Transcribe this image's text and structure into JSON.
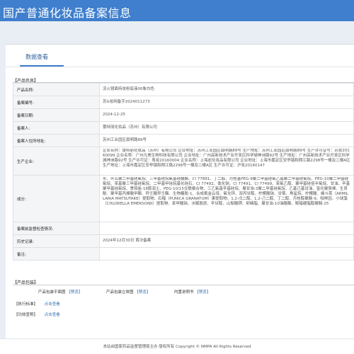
{
  "header": {
    "site_title": "国产普通化妆品备案信息"
  },
  "tabs": {
    "active": "数据查看"
  },
  "product_info": {
    "section_title": "【产品信息】",
    "rows": [
      {
        "label": "产品名称:",
        "value": "凉火镜面持妆粉底液00象白色"
      },
      {
        "label": "备案编号:",
        "value": "苏G妆网备字2024011273"
      },
      {
        "label": "备案日期:",
        "value": "2024-12-25"
      },
      {
        "label": "备案人:",
        "value": "蕾特丽化妆品（苏州）有限公司"
      },
      {
        "label": "备案人住所地址:",
        "value": "苏州工业园区扇明路89号"
      },
      {
        "label": "生产企业:",
        "value": "企业名称：蕾特丽化妆品（苏州）有限公司 企业地址：苏州工业园区扇明路89号 生产地址：苏州工业园区扇明路89号 生产许可证号：苏妆20160099 企业名称：广州凡美生物科技有限公司 企业地址：广州高新技术产业开发区科学城神洲路92号 生产地址：广州高新技术产业开发区科学城神洲路92号 生产许可证：粤妆20160004 企业名称：上海岩化妆品有限公司 企业地址：上海市嘉定区安亭镇和翔江路2298号一楼及二楼A区 生产地址：上海市嘉定区安亭镇和翔江路2298号一楼及二楼A区 生产许可证：沪妆20160147"
      },
      {
        "label": "成分:",
        "value": "水、环五聚二甲基硅氧烷、三甲基硅烷氧基硅酸酯、CI 77891、丁二醇、月桂基PEG-9聚二甲基硅氧乙基聚二甲基硅氧烷、PEG-10聚二甲基硅氧烷、苯基聚三甲基硅氧烷、二甲基甲硅烷基化硅石、CI 77492、氯化钠、CI 77491、CI 77499、苯氧乙醇、聚甲基硅倍半氧烷、甘油、辛基聚甲基硅氧烷、季铵盐-18膨润土、PEG-10/15交联聚合物、三乙氧基辛基硅烷、聚甘油-3聚二甲基硅氧烷、乙基己基甘油、氢化聚癸烯、生育酚、聚甲基丙烯酸甲酯、异壬酸异壬酯、生物糖胶-1、合成氟金云母、氧化锌、双丙甘醇、柠檬酸钠、甘菊、角鲨烷、柠檬酸、蜂斗菜（ARMILLARIA MATSUTAKE）提取物、石榴（PUNICA GRANATUM）果提取物、1,2-戊二醇、1,2-己二醇、丁二醇、月桂醇聚醚-9、咖啡因、小球藻（CHLORELLA EMERSONII）提取物、苯甲酸钠、水解胶原、辛甘醇、山梨酸钾、卵磷脂、聚甘油-10油酸酯、鲸蜡硬脂醇聚醚-25"
      },
      {
        "label": "备案前监督检查情况:",
        "value": ""
      },
      {
        "label": "历史记录:",
        "value": "2024年12月30日 首次备案"
      },
      {
        "label": "备注:",
        "value": ""
      }
    ]
  },
  "packaging": {
    "section_title": "【产品包装】",
    "items": [
      {
        "label": "产品包装平面图",
        "link": "【预览】"
      },
      {
        "label": "产品包装立体图",
        "link": "【预览】"
      },
      {
        "label": "内置说明书",
        "link": "【预览】"
      }
    ]
  },
  "standard": {
    "section_title": "【执行标准】",
    "link": "点击查看"
  },
  "efficacy": {
    "section_title": "【功效宣称】",
    "link": "点击查看"
  },
  "footer": {
    "text": "本站由国家药品监督管理局主办 版权所有 Copyright © NMPA All Rights Reserved"
  }
}
